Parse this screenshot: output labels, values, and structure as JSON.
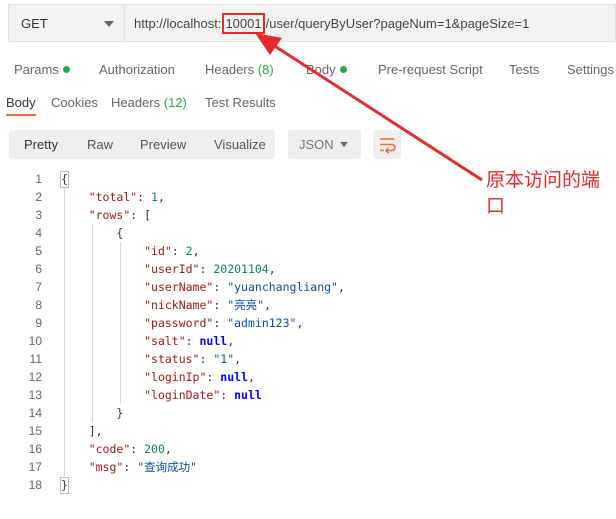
{
  "request": {
    "method": "GET",
    "url_prefix": "http://localhost:",
    "url_port": "10001",
    "url_suffix": "/user/queryByUser?pageNum=1&pageSize=1"
  },
  "request_tabs": [
    {
      "label": "Params",
      "indicator": "dot"
    },
    {
      "label": "Authorization"
    },
    {
      "label": "Headers",
      "count": "(8)"
    },
    {
      "label": "Body",
      "indicator": "dot"
    },
    {
      "label": "Pre-request Script"
    },
    {
      "label": "Tests"
    },
    {
      "label": "Settings"
    }
  ],
  "response_tabs": [
    {
      "label": "Body",
      "active": true
    },
    {
      "label": "Cookies"
    },
    {
      "label": "Headers",
      "count": "(12)"
    },
    {
      "label": "Test Results"
    }
  ],
  "toolbar": {
    "views": [
      "Pretty",
      "Raw",
      "Preview",
      "Visualize"
    ],
    "format": "JSON",
    "wrap_icon": "wrap-lines-icon"
  },
  "code_lines": [
    {
      "n": "1",
      "t": "{"
    },
    {
      "n": "2",
      "t": "    \"total\": 1,"
    },
    {
      "n": "3",
      "t": "    \"rows\": ["
    },
    {
      "n": "4",
      "t": "        {"
    },
    {
      "n": "5",
      "t": "            \"id\": 2,"
    },
    {
      "n": "6",
      "t": "            \"userId\": 20201104,"
    },
    {
      "n": "7",
      "t": "            \"userName\": \"yuanchangliang\","
    },
    {
      "n": "8",
      "t": "            \"nickName\": \"亮亮\","
    },
    {
      "n": "9",
      "t": "            \"password\": \"admin123\","
    },
    {
      "n": "10",
      "t": "            \"salt\": null,"
    },
    {
      "n": "11",
      "t": "            \"status\": \"1\","
    },
    {
      "n": "12",
      "t": "            \"loginIp\": null,"
    },
    {
      "n": "13",
      "t": "            \"loginDate\": null"
    },
    {
      "n": "14",
      "t": "        }"
    },
    {
      "n": "15",
      "t": "    ],"
    },
    {
      "n": "16",
      "t": "    \"code\": 200,"
    },
    {
      "n": "17",
      "t": "    \"msg\": \"查询成功\""
    },
    {
      "n": "18",
      "t": "}"
    }
  ],
  "annotation": {
    "text": "原本访问的端口",
    "color": "#e52a2a"
  },
  "colors": {
    "accent": "#f26b3a",
    "ok_dot": "#2ea44f",
    "key": "#a31515",
    "string": "#0451a5",
    "number": "#098658",
    "null": "#0000ff"
  }
}
